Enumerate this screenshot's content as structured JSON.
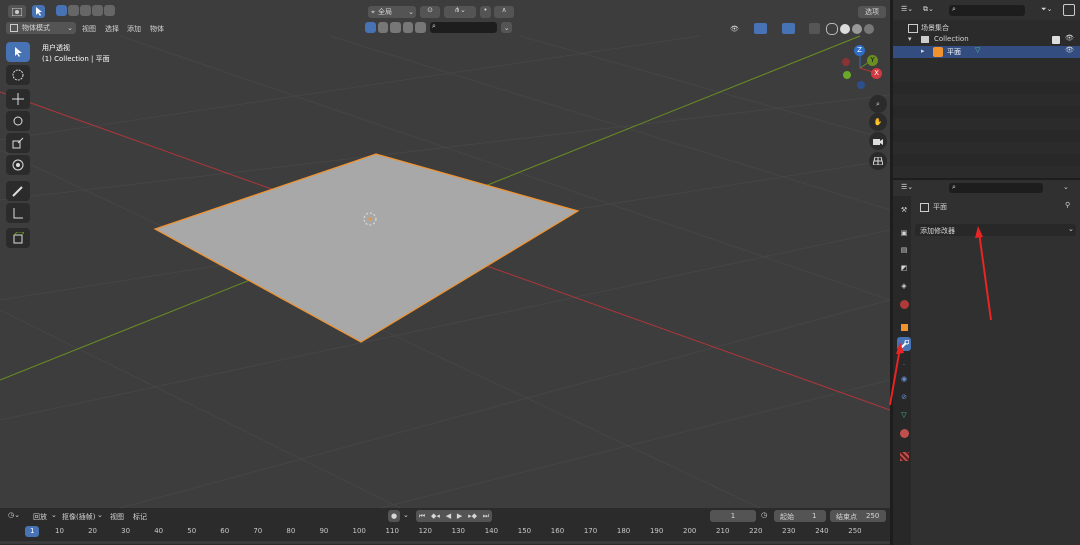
{
  "viewport": {
    "mode_label": "物体模式",
    "menu": [
      "视图",
      "选择",
      "添加",
      "物体"
    ],
    "transform_orientation": "全局",
    "options_label": "选项",
    "view_name": "用户透视",
    "object_info": "(1) Collection | 平面",
    "colors": {
      "selected_outline": "#f0922e",
      "plane_fill": "#a8a8a8",
      "x_axis": "#b2363b",
      "y_axis": "#6a8e22",
      "accent": "#4772b3"
    }
  },
  "gizmo": {
    "z": "Z",
    "y": "Y",
    "x": "X"
  },
  "outliner": {
    "scene_collection": "场景集合",
    "collection": "Collection",
    "object": "平面"
  },
  "properties": {
    "object_name": "平面",
    "add_modifier": "添加修改器"
  },
  "timeline": {
    "menu": [
      "回放",
      "抠像(插帧)",
      "视图",
      "标记"
    ],
    "current_frame": "1",
    "start_label": "起始",
    "start_value": "1",
    "end_label": "结束点",
    "end_value": "250",
    "ruler": [
      "1",
      "10",
      "20",
      "30",
      "40",
      "50",
      "60",
      "70",
      "80",
      "90",
      "100",
      "110",
      "120",
      "130",
      "140",
      "150",
      "160",
      "170",
      "180",
      "190",
      "200",
      "210",
      "220",
      "230",
      "240",
      "250"
    ]
  }
}
